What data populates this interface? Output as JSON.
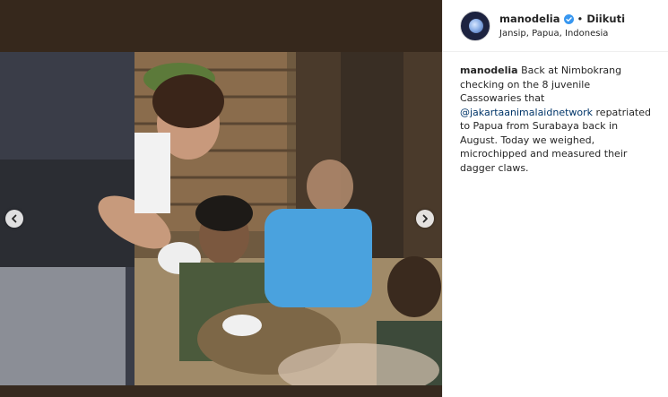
{
  "post": {
    "username": "manodelia",
    "follow_label": "Diikuti",
    "location": "Jansip, Papua, Indonesia",
    "caption": {
      "username": "manodelia",
      "text_before": " Back at Nimbokrang checking on the 8 juvenile Cassowaries that ",
      "mention": "@jakartaanimalaidnetwork",
      "text_after": " repatriated to Papua from Surabaya back in August. Today we weighed, microchipped and measured their dagger claws."
    }
  },
  "icons": {
    "prev": "chevron-left-icon",
    "next": "chevron-right-icon",
    "verified": "verified-badge-icon"
  },
  "colors": {
    "accent_blue": "#3897f0",
    "mention_blue": "#003569",
    "text": "#262626",
    "border": "#efefef"
  }
}
